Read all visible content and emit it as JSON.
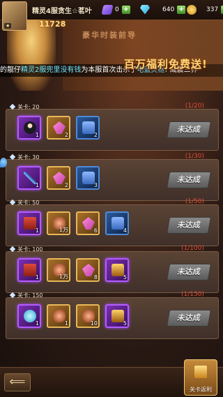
{
  "topbar": {
    "player_name": "精灵4服贪生☆茗叶",
    "resources": [
      {
        "icon": "ticket-icon",
        "value": "0"
      },
      {
        "icon": "diamond-icon",
        "value": "640"
      },
      {
        "icon": "gold-coin-icon",
        "value": "337"
      }
    ]
  },
  "banner": {
    "power": "11728",
    "subtitle": "豪华时装前导",
    "title": "百万福利免费送!",
    "marquee": {
      "part1": "的靓仔",
      "part2": "精灵2服兜里没有钱",
      "part3": "为本服首次击杀了",
      "part4": "电蓝灵枢",
      "part5": "! 威震三界"
    }
  },
  "tasks": [
    {
      "header": "关卡: 20",
      "progress": "(1/20)",
      "button": "未达成",
      "items": [
        {
          "icon": "ninja-icon",
          "rarity": "purple",
          "count": "1"
        },
        {
          "icon": "crystal-icon",
          "rarity": "gold",
          "count": "2"
        },
        {
          "icon": "blue-chest-icon",
          "rarity": "blue",
          "count": "2"
        }
      ]
    },
    {
      "header": "关卡: 30",
      "progress": "(1/30)",
      "button": "未达成",
      "items": [
        {
          "icon": "spear-icon",
          "rarity": "purple",
          "count": "1"
        },
        {
          "icon": "crystal-icon",
          "rarity": "gold",
          "count": "2"
        },
        {
          "icon": "blue-chest-icon",
          "rarity": "blue",
          "count": "3"
        }
      ]
    },
    {
      "header": "关卡: 50",
      "progress": "(1/50)",
      "button": "未达成",
      "items": [
        {
          "icon": "book-icon",
          "rarity": "purple",
          "count": "1"
        },
        {
          "icon": "meat-icon",
          "rarity": "gold",
          "count": "1万"
        },
        {
          "icon": "crystal-icon",
          "rarity": "gold",
          "count": "6"
        },
        {
          "icon": "blue-chest-icon",
          "rarity": "blue",
          "count": "4"
        }
      ]
    },
    {
      "header": "关卡: 100",
      "progress": "(1/100)",
      "button": "未达成",
      "items": [
        {
          "icon": "book-icon",
          "rarity": "purple",
          "count": "1"
        },
        {
          "icon": "meat-icon",
          "rarity": "gold",
          "count": "1万"
        },
        {
          "icon": "crystal-icon",
          "rarity": "gold",
          "count": "8"
        },
        {
          "icon": "gold-chest-icon",
          "rarity": "purple",
          "count": "5"
        }
      ]
    },
    {
      "header": "关卡: 150",
      "progress": "(1/150)",
      "button": "未达成",
      "items": [
        {
          "icon": "orb-icon",
          "rarity": "purple",
          "count": "1"
        },
        {
          "icon": "meat-icon",
          "rarity": "gold",
          "count": "1"
        },
        {
          "icon": "meat-icon",
          "rarity": "gold",
          "count": "10"
        },
        {
          "icon": "gold-chest-icon",
          "rarity": "purple",
          "count": "5"
        }
      ]
    }
  ],
  "bottombar": {
    "back_symbol": "⟸",
    "rebate_label": "关卡返利"
  }
}
